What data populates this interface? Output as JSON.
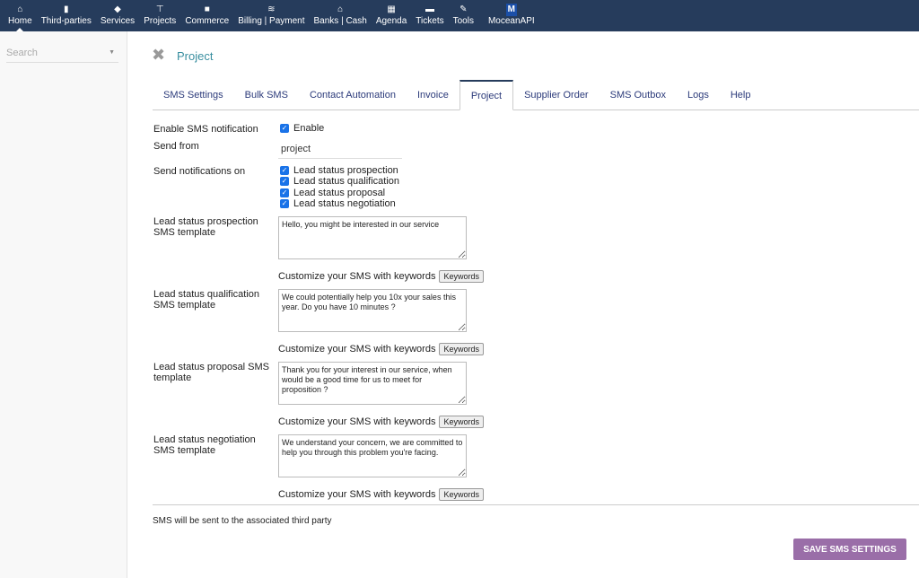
{
  "nav": [
    {
      "label": "Home",
      "icon": "home-icon",
      "glyph": "⌂"
    },
    {
      "label": "Third-parties",
      "icon": "building-icon",
      "glyph": "▮"
    },
    {
      "label": "Services",
      "icon": "cube-icon",
      "glyph": "◆"
    },
    {
      "label": "Projects",
      "icon": "sitemap-icon",
      "glyph": "⊤"
    },
    {
      "label": "Commerce",
      "icon": "briefcase-icon",
      "glyph": "■"
    },
    {
      "label": "Billing | Payment",
      "icon": "coins-icon",
      "glyph": "≋"
    },
    {
      "label": "Banks | Cash",
      "icon": "bank-icon",
      "glyph": "⌂"
    },
    {
      "label": "Agenda",
      "icon": "calendar-icon",
      "glyph": "▦"
    },
    {
      "label": "Tickets",
      "icon": "ticket-icon",
      "glyph": "▬"
    },
    {
      "label": "Tools",
      "icon": "wrench-icon",
      "glyph": "✎"
    },
    {
      "label": "MoceanAPI",
      "icon": "mocean-icon",
      "glyph": "M"
    }
  ],
  "sidebar": {
    "search_placeholder": "Search"
  },
  "page": {
    "title": "Project"
  },
  "tabs": [
    "SMS Settings",
    "Bulk SMS",
    "Contact Automation",
    "Invoice",
    "Project",
    "Supplier Order",
    "SMS Outbox",
    "Logs",
    "Help"
  ],
  "form": {
    "enable_label": "Enable SMS notification",
    "enable_option": "Enable",
    "send_from_label": "Send from",
    "send_from_value": "project",
    "notify_label": "Send notifications on",
    "notify_options": [
      "Lead status prospection",
      "Lead status qualification",
      "Lead status proposal",
      "Lead status negotiation"
    ],
    "templates": [
      {
        "label": "Lead status prospection SMS template",
        "value": "Hello, you might be interested in our service"
      },
      {
        "label": "Lead status qualification SMS template",
        "value": "We could potentially help you 10x your sales this year. Do you have 10 minutes ?"
      },
      {
        "label": "Lead status proposal SMS template",
        "value": "Thank you for your interest in our service, when would be a good time for us to meet for proposition ?"
      },
      {
        "label": "Lead status negotiation SMS template",
        "value": "We understand your concern, we are committed to help you through this problem you're facing."
      }
    ],
    "customize_text": "Customize your SMS with keywords",
    "keywords_button": "Keywords",
    "note": "SMS will be sent to the associated third party",
    "save_button": "SAVE SMS SETTINGS"
  }
}
